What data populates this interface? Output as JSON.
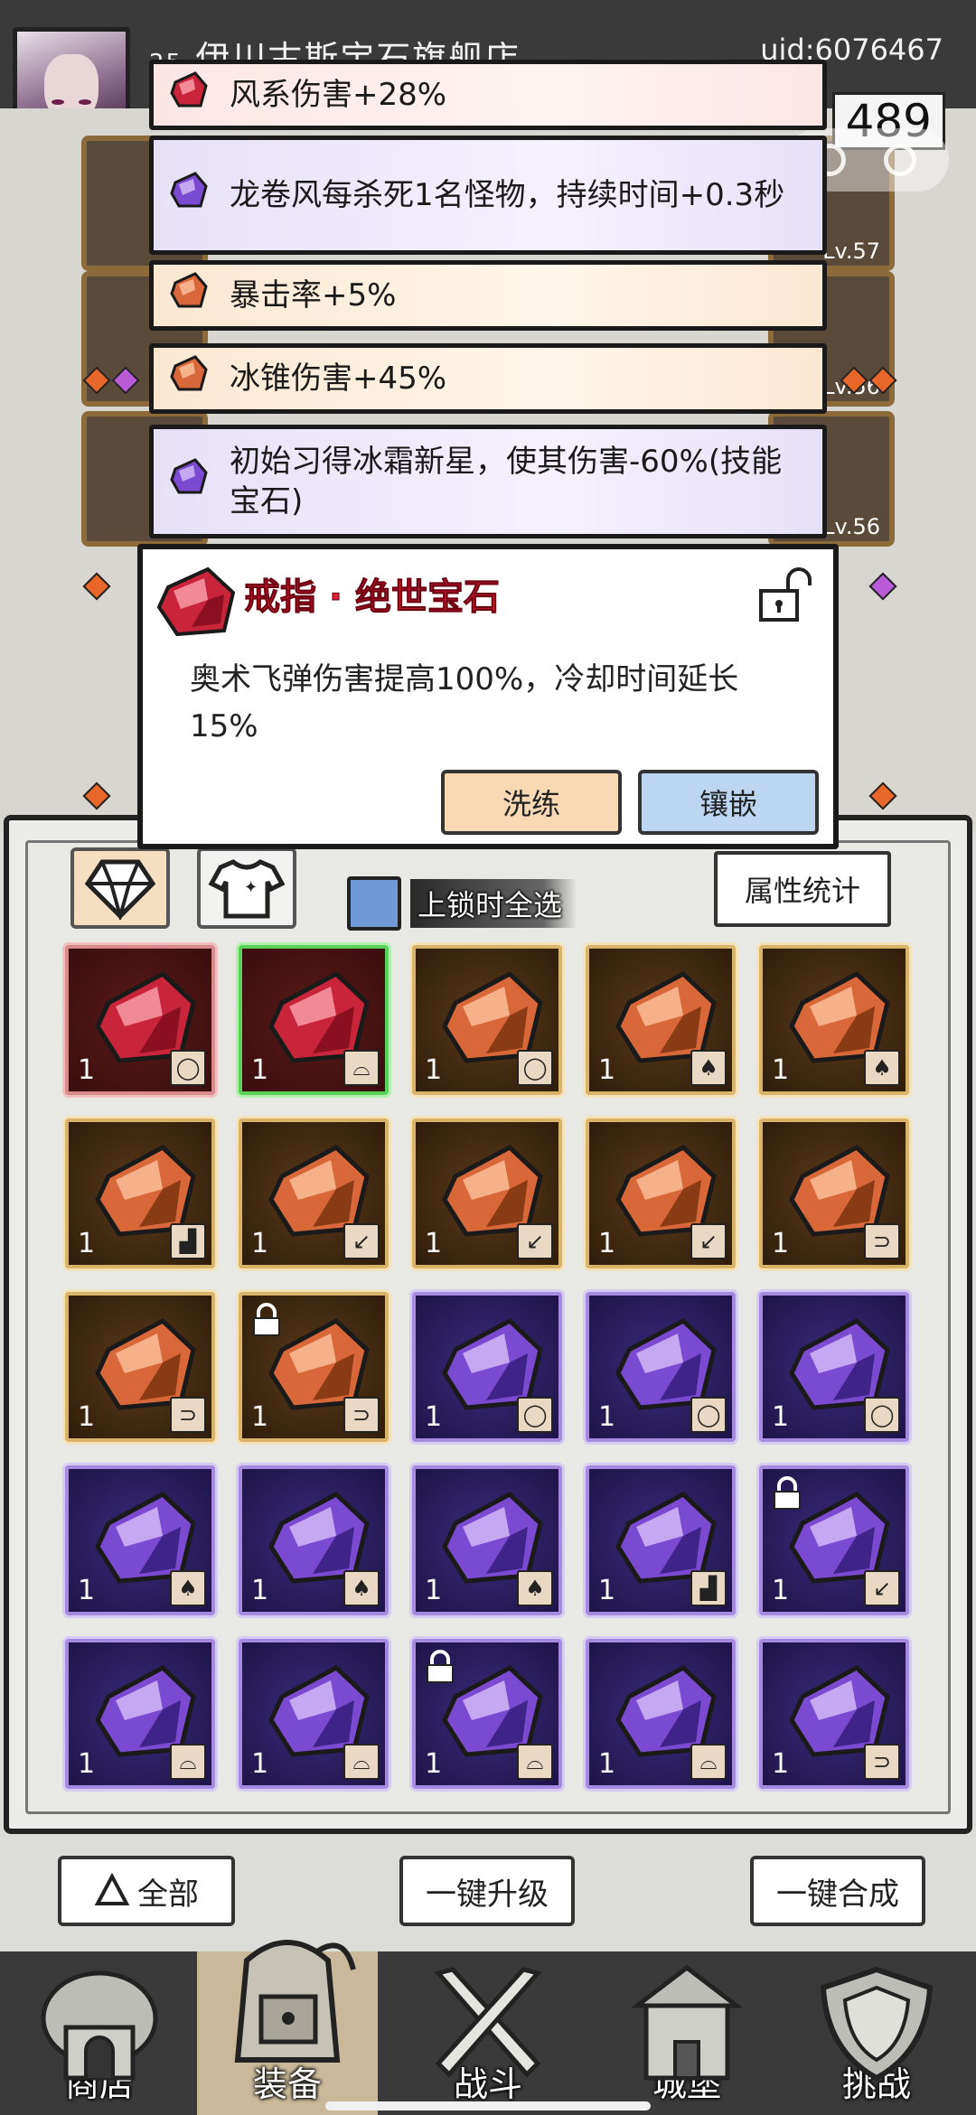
{
  "header": {
    "level": "25",
    "shop_name": "伊川古斯宝石旗舰店",
    "uid": "uid:6076467",
    "coin": "489"
  },
  "equipment_levels": [
    "Lv.57",
    "Lv.56",
    "Lv.56"
  ],
  "tooltips": [
    {
      "gem": "red",
      "text": "风系伤害+28%"
    },
    {
      "gem": "purple",
      "text": "龙卷风每杀死1名怪物，持续时间+0.3秒"
    },
    {
      "gem": "orange",
      "text": "暴击率+5%"
    },
    {
      "gem": "orange",
      "text": "冰锥伤害+45%"
    },
    {
      "gem": "purple",
      "text": "初始习得冰霜新星，使其伤害-60%(技能宝石)"
    }
  ],
  "popup": {
    "title": "戒指 · 绝世宝石",
    "description": "奥术飞弹伤害提高100%，冷却时间延长15%",
    "refine_label": "洗练",
    "inlay_label": "镶嵌"
  },
  "inventory": {
    "lock_select_label": "上锁时全选",
    "stats_label": "属性统计",
    "items": [
      {
        "tier": "red",
        "qty": "1",
        "slot": "ring",
        "selected": false,
        "locked": false
      },
      {
        "tier": "red",
        "qty": "1",
        "slot": "hat",
        "selected": true,
        "locked": false
      },
      {
        "tier": "orange",
        "qty": "1",
        "slot": "ring",
        "selected": false,
        "locked": false
      },
      {
        "tier": "orange",
        "qty": "1",
        "slot": "armor",
        "selected": false,
        "locked": false
      },
      {
        "tier": "orange",
        "qty": "1",
        "slot": "armor",
        "selected": false,
        "locked": false
      },
      {
        "tier": "orange",
        "qty": "1",
        "slot": "boot",
        "selected": false,
        "locked": false
      },
      {
        "tier": "orange",
        "qty": "1",
        "slot": "weapon",
        "selected": false,
        "locked": false
      },
      {
        "tier": "orange",
        "qty": "1",
        "slot": "weapon",
        "selected": false,
        "locked": false
      },
      {
        "tier": "orange",
        "qty": "1",
        "slot": "weapon",
        "selected": false,
        "locked": false
      },
      {
        "tier": "orange",
        "qty": "1",
        "slot": "necklace",
        "selected": false,
        "locked": false
      },
      {
        "tier": "orange",
        "qty": "1",
        "slot": "necklace",
        "selected": false,
        "locked": false
      },
      {
        "tier": "orange",
        "qty": "1",
        "slot": "necklace",
        "selected": false,
        "locked": true
      },
      {
        "tier": "purple",
        "qty": "1",
        "slot": "ring",
        "selected": false,
        "locked": false
      },
      {
        "tier": "purple",
        "qty": "1",
        "slot": "ring",
        "selected": false,
        "locked": false
      },
      {
        "tier": "purple",
        "qty": "1",
        "slot": "ring",
        "selected": false,
        "locked": false
      },
      {
        "tier": "purple",
        "qty": "1",
        "slot": "armor",
        "selected": false,
        "locked": false
      },
      {
        "tier": "purple",
        "qty": "1",
        "slot": "armor",
        "selected": false,
        "locked": false
      },
      {
        "tier": "purple",
        "qty": "1",
        "slot": "armor",
        "selected": false,
        "locked": false
      },
      {
        "tier": "purple",
        "qty": "1",
        "slot": "boot",
        "selected": false,
        "locked": false
      },
      {
        "tier": "purple",
        "qty": "1",
        "slot": "weapon",
        "selected": false,
        "locked": true
      },
      {
        "tier": "purple",
        "qty": "1",
        "slot": "hat",
        "selected": false,
        "locked": false
      },
      {
        "tier": "purple",
        "qty": "1",
        "slot": "hat",
        "selected": false,
        "locked": false
      },
      {
        "tier": "purple",
        "qty": "1",
        "slot": "hat",
        "selected": false,
        "locked": true
      },
      {
        "tier": "purple",
        "qty": "1",
        "slot": "hat",
        "selected": false,
        "locked": false
      },
      {
        "tier": "purple",
        "qty": "1",
        "slot": "necklace",
        "selected": false,
        "locked": false
      }
    ]
  },
  "actions": {
    "filter_label": "全部",
    "upgrade_all_label": "一键升级",
    "merge_all_label": "一键合成"
  },
  "nav": [
    {
      "label": "商店",
      "icon": "shop-icon",
      "active": false
    },
    {
      "label": "装备",
      "icon": "backpack-icon",
      "active": true
    },
    {
      "label": "战斗",
      "icon": "crossed-swords-icon",
      "active": false
    },
    {
      "label": "城堡",
      "icon": "castle-icon",
      "active": false
    },
    {
      "label": "挑战",
      "icon": "shield-icon",
      "active": false
    }
  ],
  "colors": {
    "red_gem": "#c8243a",
    "orange_gem": "#d8683a",
    "purple_gem": "#7a4ad0",
    "title_red": "#e0203a"
  }
}
